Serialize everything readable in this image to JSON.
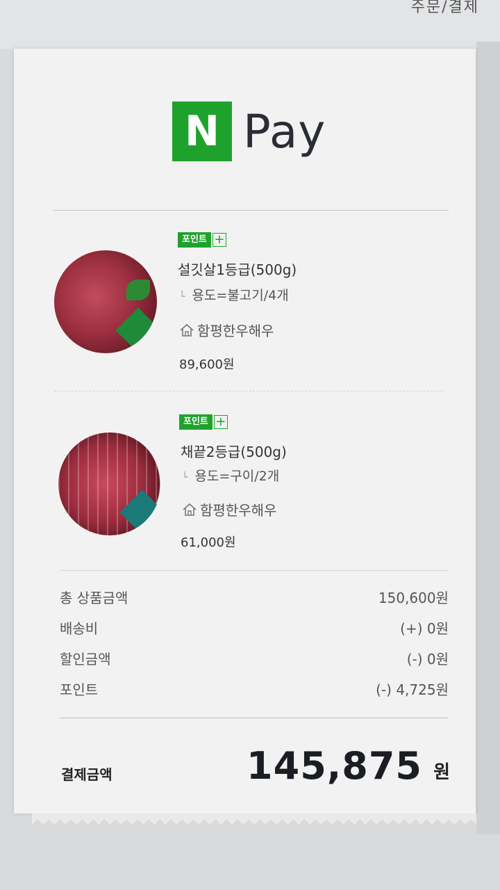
{
  "header": {
    "breadcrumb": "주문/결제"
  },
  "logo": {
    "mark": "N",
    "text": "Pay",
    "brand_color": "#1fa22c"
  },
  "items": [
    {
      "badge": "포인트",
      "badge_plus": "+",
      "name": "설깃살1등급(500g)",
      "option": "용도=불고기/4개",
      "store": "함평한우해우",
      "price": "89,600원",
      "thumb_grade_icon": "grade-1-ribbon"
    },
    {
      "badge": "포인트",
      "badge_plus": "+",
      "name": "채끝2등급(500g)",
      "option": "용도=구이/2개",
      "store": "함평한우해우",
      "price": "61,000원",
      "thumb_grade_icon": "grade-2-ribbon"
    }
  ],
  "summary": [
    {
      "label": "총 상품금액",
      "value": "150,600원"
    },
    {
      "label": "배송비",
      "value": "(+) 0원"
    },
    {
      "label": "할인금액",
      "value": "(-) 0원"
    },
    {
      "label": "포인트",
      "value": "(-) 4,725원"
    }
  ],
  "total": {
    "label": "결제금액",
    "amount": "145,875",
    "currency": "원"
  }
}
